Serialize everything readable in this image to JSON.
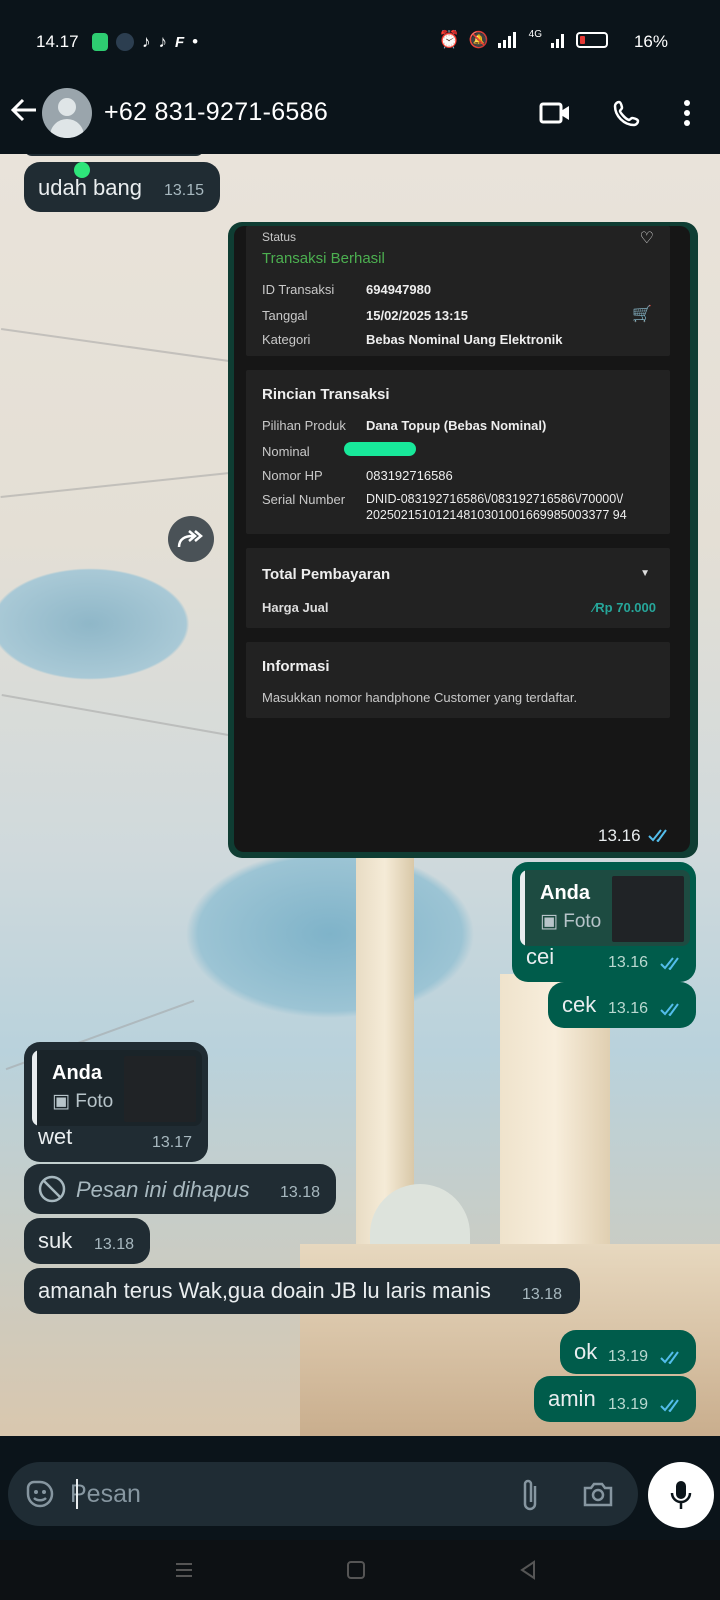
{
  "status_bar": {
    "time": "14.17",
    "dot": "•",
    "network": "4G",
    "battery": "16%",
    "battery_icon_color": "#e53935"
  },
  "header": {
    "contact": "+62 831-9271-6586",
    "icons": [
      "back-arrow-icon",
      "video-call-icon",
      "voice-call-icon",
      "more-menu-icon"
    ]
  },
  "messages": {
    "m1": {
      "text": "udah bang",
      "time": "13.15"
    },
    "image": {
      "time": "13.16",
      "status_label": "Status",
      "status_value": "Transaksi Berhasil",
      "id_label": "ID Transaksi",
      "id_value": "694947980",
      "date_label": "Tanggal",
      "date_value": "15/02/2025 13:15",
      "category_label": "Kategori",
      "category_value": "Bebas Nominal Uang Elektronik",
      "details_title": "Rincian Transaksi",
      "product_label": "Pilihan Produk",
      "product_value": "Dana Topup (Bebas Nominal)",
      "nominal_label": "Nominal",
      "phone_label": "Nomor HP",
      "phone_value": "083192716586",
      "serial_label": "Serial Number",
      "serial_line1": "DNID-083192716586\\/083192716586\\/70000\\/",
      "serial_line2": "20250215101214810301001669985003377 94",
      "total_title": "Total Pembayaran",
      "price_label": "Harga Jual",
      "price_value": "Rp 70.000",
      "info_title": "Informasi",
      "info_text": "Masukkan nomor handphone Customer yang terdaftar."
    },
    "m3": {
      "quote_name": "Anda",
      "quote_sub": "Foto",
      "text": "cei",
      "time": "13.16"
    },
    "m4": {
      "text": "cek",
      "time": "13.16"
    },
    "m5": {
      "quote_name": "Anda",
      "quote_sub": "Foto",
      "text": "wet",
      "time": "13.17"
    },
    "m6": {
      "text": "Pesan ini dihapus",
      "time": "13.18"
    },
    "m7": {
      "text": "suk",
      "time": "13.18"
    },
    "m8": {
      "text": "amanah terus Wak,gua doain JB lu laris manis",
      "time": "13.18"
    },
    "m9": {
      "text": "ok",
      "time": "13.19"
    },
    "m10": {
      "text": "amin",
      "time": "13.19"
    }
  },
  "input": {
    "placeholder": "Pesan"
  },
  "colors": {
    "incoming": "#202c33",
    "outgoing": "#005c4b",
    "read_ticks": "#53bdeb",
    "success_green": "#4caf50"
  }
}
